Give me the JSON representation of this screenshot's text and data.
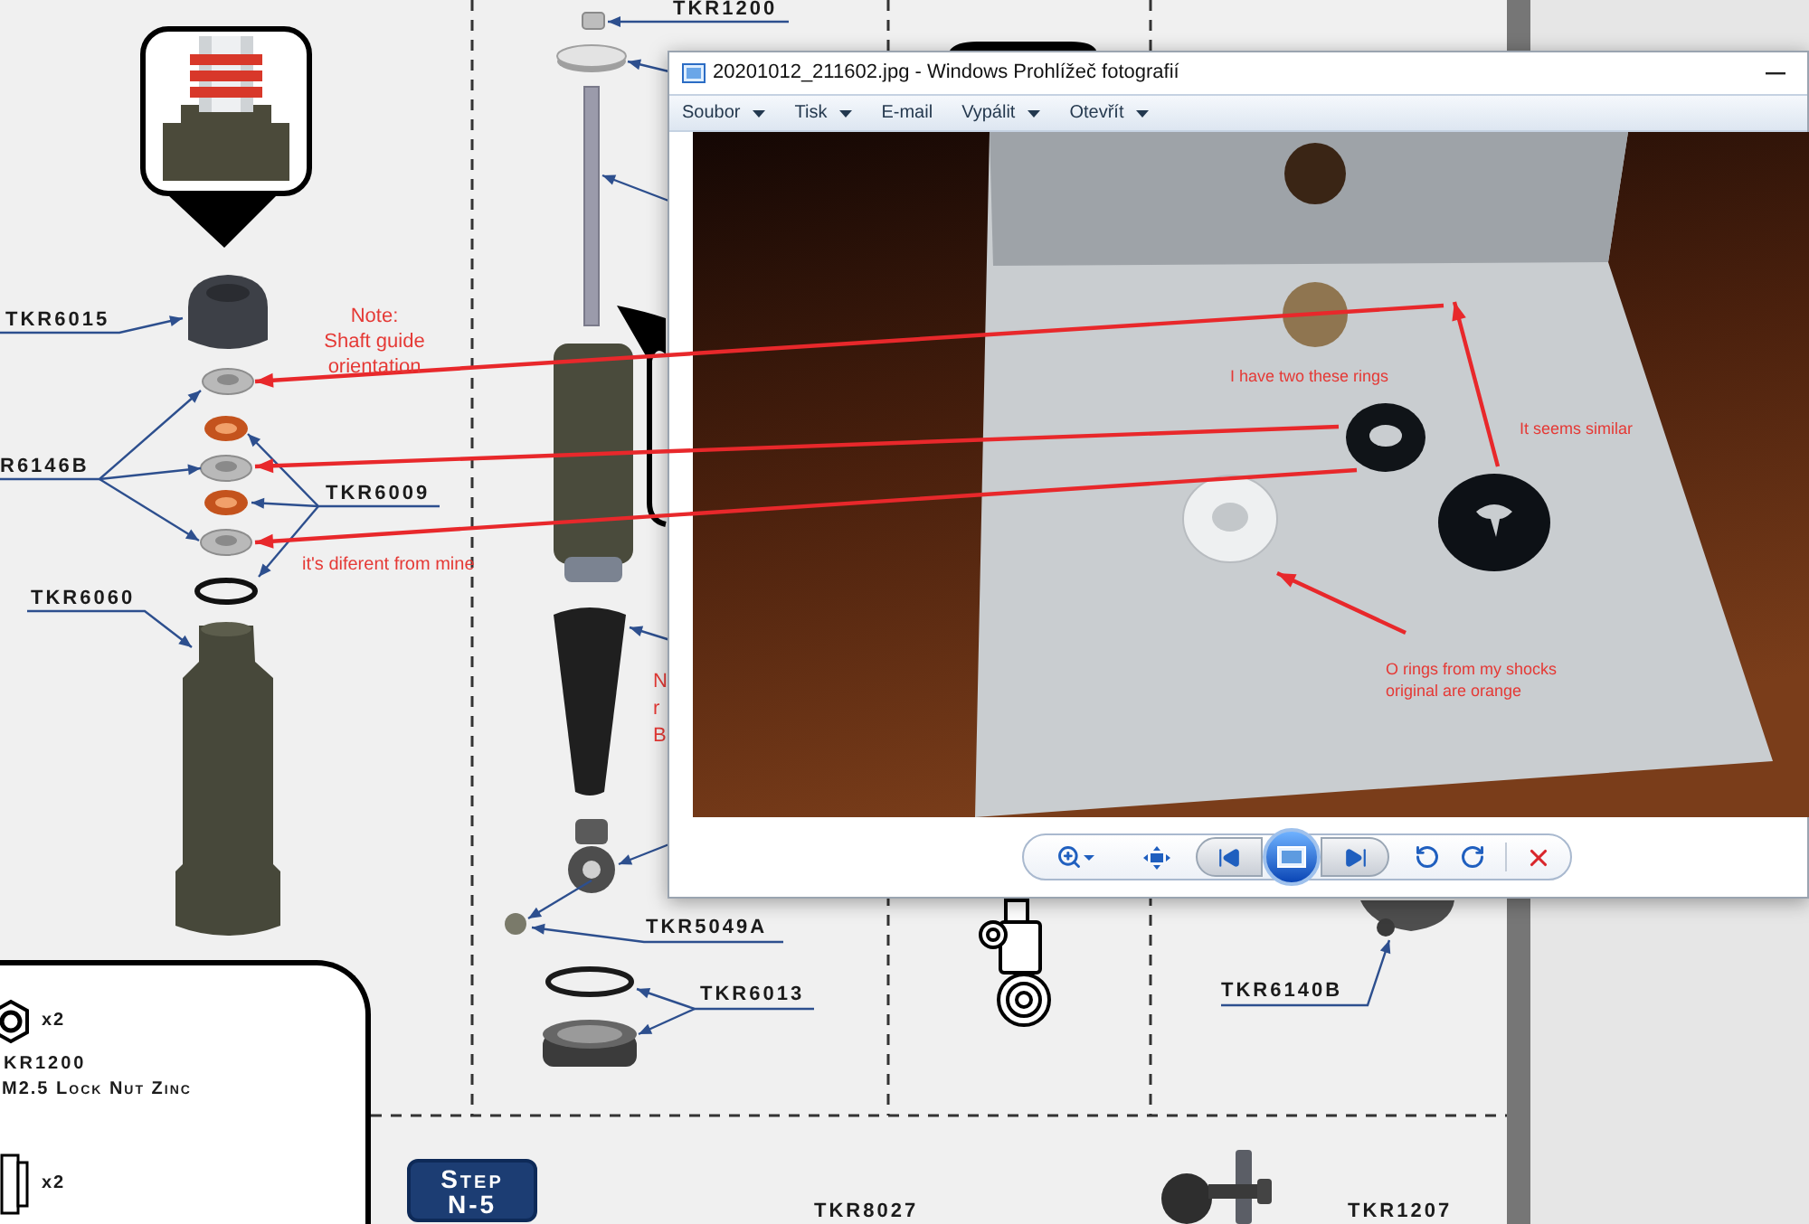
{
  "manual": {
    "part_labels": [
      "TKR1200",
      "TKR6015",
      "R6146B",
      "TKR6009",
      "TKR6060",
      "TKR5049A",
      "TKR6013",
      "TKR6140B",
      "TKR8027",
      "TKR1207"
    ],
    "partial_note": {
      "lines": [
        "N",
        "r",
        "B"
      ]
    },
    "hardware_box": {
      "items": [
        {
          "kind": "hex-nut",
          "count": "x2",
          "code": "KR1200",
          "name": "M2.5 Lock Nut Zinc"
        },
        {
          "kind": "nut-side",
          "count": "x2"
        }
      ]
    },
    "step_badge": {
      "lines": [
        "Step",
        "N-5"
      ]
    }
  },
  "photo_viewer": {
    "title": "20201012_211602.jpg - Windows Prohlížeč fotografií",
    "menu": [
      {
        "label": "Soubor",
        "dropdown": true
      },
      {
        "label": "Tisk",
        "dropdown": true
      },
      {
        "label": "E-mail",
        "dropdown": false
      },
      {
        "label": "Vypálit",
        "dropdown": true
      },
      {
        "label": "Otevřít",
        "dropdown": true
      }
    ]
  },
  "annotations": [
    {
      "lines": [
        "Note:",
        "Shaft guide",
        "orientation"
      ]
    },
    {
      "lines": [
        "it's diferent from mine"
      ]
    },
    {
      "lines": [
        "I have two these rings"
      ]
    },
    {
      "lines": [
        "It seems similar"
      ]
    },
    {
      "lines": [
        "O rings from my shocks",
        "original are orange"
      ]
    }
  ]
}
